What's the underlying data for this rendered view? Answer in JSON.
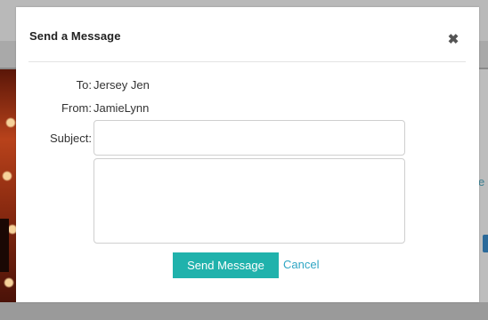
{
  "modal": {
    "title": "Send a Message",
    "close_icon": "close-icon",
    "to_label": "To:",
    "to_value": "Jersey Jen",
    "from_label": "From:",
    "from_value": "JamieLynn",
    "subject_label": "Subject:",
    "subject_value": "",
    "message_value": "",
    "send_label": "Send Message",
    "cancel_label": "Cancel"
  },
  "background": {
    "link_fragment": "e"
  },
  "colors": {
    "accent": "#20b2ac",
    "link": "#2fa6c4",
    "overlay": "#8a8a8a"
  }
}
